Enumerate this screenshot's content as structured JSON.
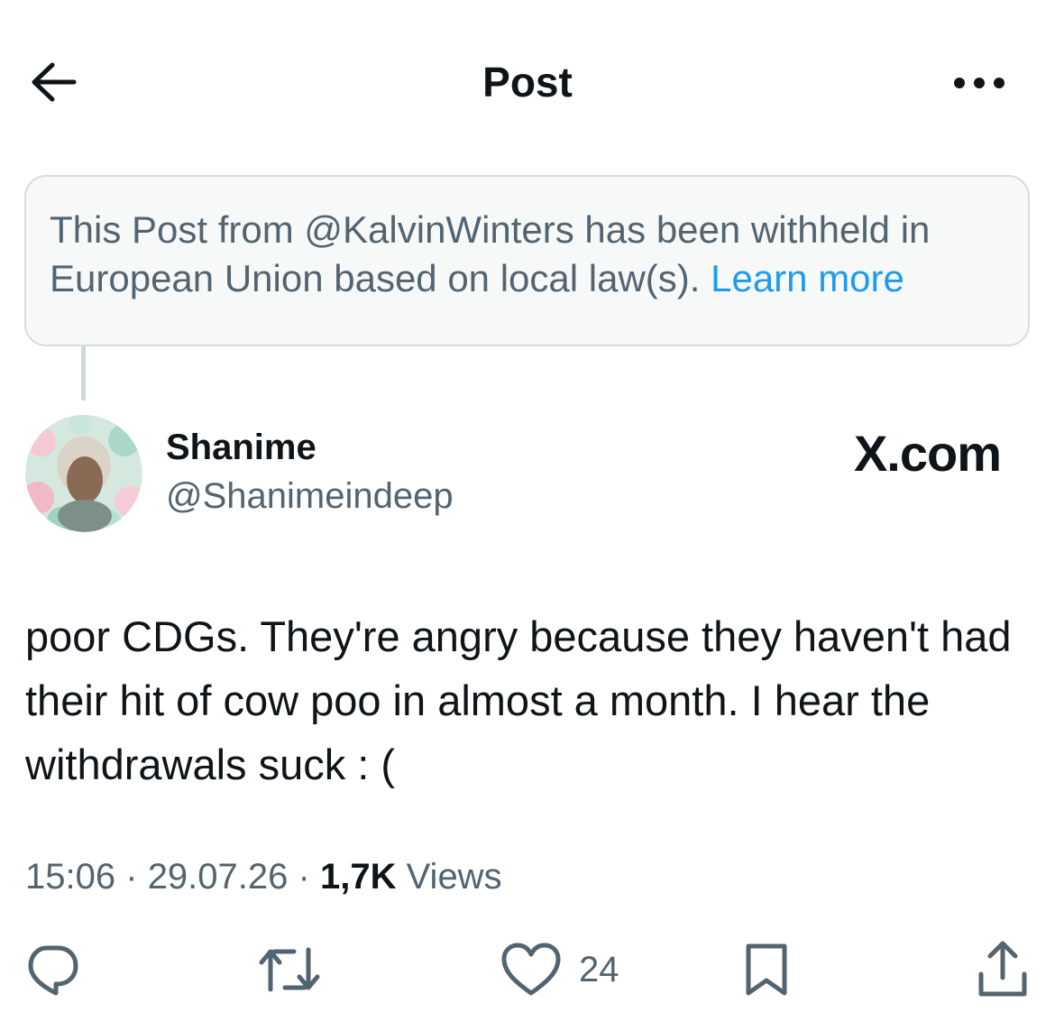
{
  "header": {
    "title": "Post",
    "back_icon": "back-arrow-icon",
    "more_icon": "more-icon"
  },
  "withheld_notice": {
    "text": "This Post from @KalvinWinters has been withheld in European Union based on local law(s).",
    "link_label": "Learn more"
  },
  "post": {
    "author_name": "Shanime",
    "author_handle": "@Shanimeindeep",
    "watermark": "X.com",
    "text": "poor CDGs. They're angry because they haven't had their hit of cow poo in almost a month. I hear the withdrawals suck : (",
    "time": "15:06",
    "date": "29.07.26",
    "separator": "·",
    "views_count": "1,7K",
    "views_label": "Views"
  },
  "actions": {
    "reply_icon": "reply-icon",
    "repost_icon": "repost-icon",
    "like_icon": "heart-icon",
    "like_count": "24",
    "bookmark_icon": "bookmark-icon",
    "share_icon": "share-icon"
  },
  "colors": {
    "text_primary": "#0f1419",
    "text_secondary": "#536471",
    "link": "#1d9bf0",
    "notice_bg": "#f7f9f9",
    "notice_border": "#d6dce0"
  }
}
